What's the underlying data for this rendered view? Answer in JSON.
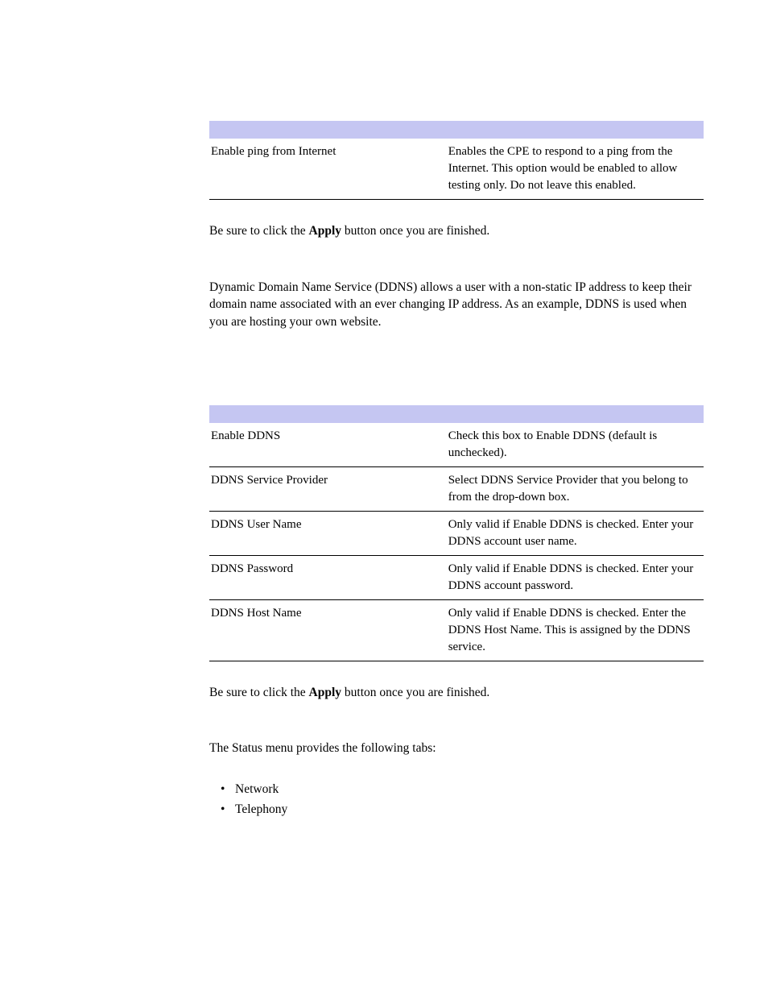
{
  "table1": {
    "rows": [
      {
        "field": "Enable ping from Internet",
        "description": "Enables the CPE to respond to a ping from the Internet. This option would be enabled to allow testing only. Do not leave this enabled."
      }
    ]
  },
  "apply_note_prefix": "Be sure to click the ",
  "apply_note_bold": "Apply",
  "apply_note_suffix": " button once you are finished.",
  "ddns_intro": "Dynamic Domain Name Service (DDNS) allows a user with a non-static IP address to keep their domain name associated with an ever changing IP address. As an example, DDNS is used when you are hosting your own website.",
  "table2": {
    "rows": [
      {
        "field": "Enable DDNS",
        "description": "Check this box to Enable DDNS (default is unchecked)."
      },
      {
        "field": "DDNS Service Provider",
        "description": "Select DDNS Service Provider that you belong to from the drop-down box."
      },
      {
        "field": "DDNS User Name",
        "description": "Only valid if Enable DDNS is checked. Enter your DDNS account user name."
      },
      {
        "field": "DDNS Password",
        "description": "Only valid if Enable DDNS is checked. Enter your DDNS account password."
      },
      {
        "field": "DDNS Host Name",
        "description": "Only valid if Enable DDNS is checked. Enter the DDNS Host Name. This is assigned by the DDNS service."
      }
    ]
  },
  "status_intro": "The Status menu provides the following tabs:",
  "status_tabs": [
    "Network",
    "Telephony"
  ]
}
